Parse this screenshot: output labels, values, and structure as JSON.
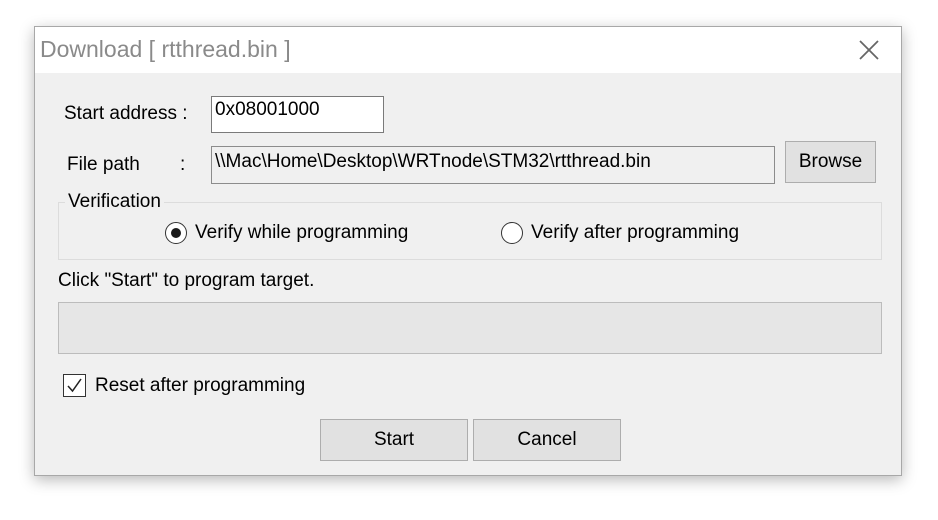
{
  "window": {
    "title": "Download [ rtthread.bin ]",
    "close_icon": "close-icon"
  },
  "form": {
    "start_address_label": "Start address :",
    "start_address_value": "0x08001000",
    "file_path_label": "File path",
    "file_path_colon": ":",
    "file_path_value": "\\\\Mac\\Home\\Desktop\\WRTnode\\STM32\\rtthread.bin",
    "browse_label": "Browse"
  },
  "verification": {
    "legend": "Verification",
    "options": [
      {
        "label": "Verify while programming",
        "selected": true
      },
      {
        "label": "Verify after programming",
        "selected": false
      }
    ]
  },
  "status": {
    "message": "Click \"Start\" to program target.",
    "progress": 0
  },
  "options": {
    "reset_label": "Reset after programming",
    "reset_checked": true
  },
  "actions": {
    "start_label": "Start",
    "cancel_label": "Cancel"
  }
}
